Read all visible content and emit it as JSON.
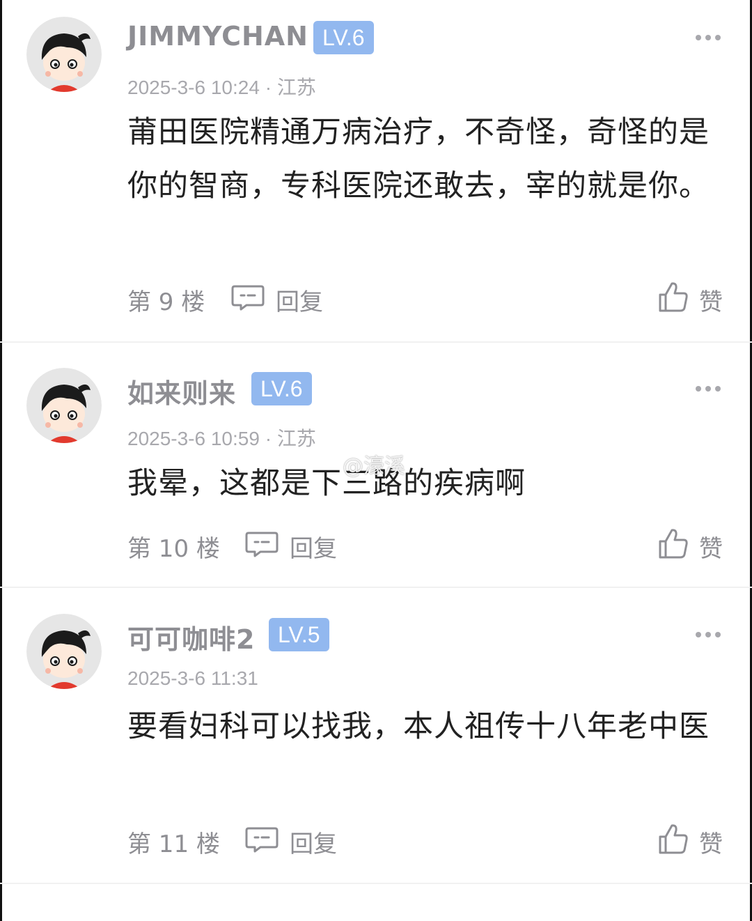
{
  "comments": [
    {
      "username": "JIMMYCHAN",
      "level": "LV.6",
      "meta": "2025-3-6 10:24 · 江苏",
      "content": "莆田医院精通万病治疗，不奇怪，奇怪的是你的智商，专科医院还敢去，宰的就是你。",
      "floor": "第 9 楼",
      "reply_label": "回复",
      "like_label": "赞"
    },
    {
      "username": "如来则来",
      "level": "LV.6",
      "meta": "2025-3-6 10:59 · 江苏",
      "content": "我晕，这都是下三路的疾病啊",
      "floor": "第 10 楼",
      "reply_label": "回复",
      "like_label": "赞"
    },
    {
      "username": "可可咖啡2",
      "level": "LV.5",
      "meta": "2025-3-6 11:31",
      "content": "要看妇科可以找我，本人祖传十八年老中医",
      "floor": "第 11 楼",
      "reply_label": "回复",
      "like_label": "赞"
    }
  ],
  "watermark": "@濠溪",
  "icons": {
    "avatar": "cartoon-avatar",
    "more": "more-dots-icon",
    "reply": "comment-bubble-icon",
    "like": "thumbs-up-icon"
  },
  "colors": {
    "level_badge": "#92b8ef",
    "secondary_text": "#8e8e93",
    "body_text": "#222222"
  }
}
